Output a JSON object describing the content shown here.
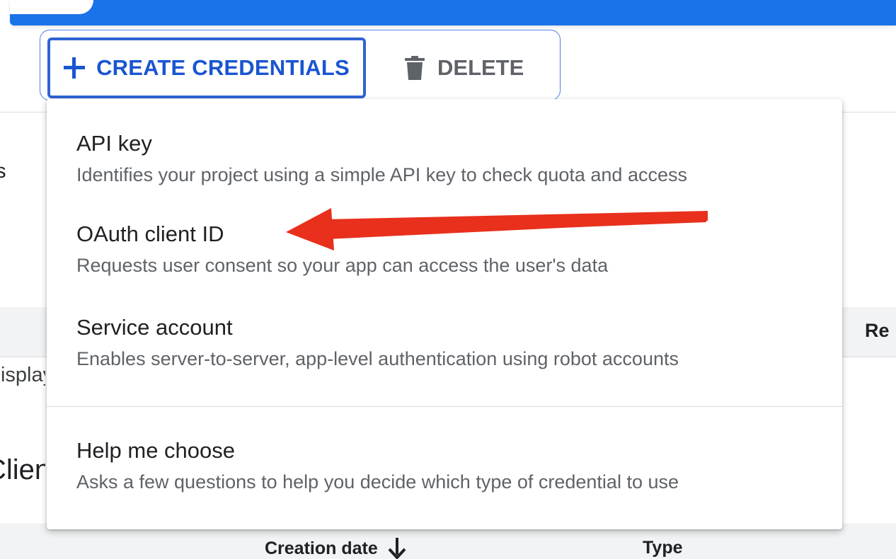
{
  "toolbar": {
    "create_label": "CREATE CREDENTIALS",
    "delete_label": "DELETE"
  },
  "background": {
    "fragment_1": "to access",
    "fragment_2": "Display name",
    "fragment_3": "Client",
    "fragment_4": "Re",
    "columns": [
      "Creation date",
      "Type"
    ]
  },
  "menu": {
    "items": [
      {
        "title": "API key",
        "description": "Identifies your project using a simple API key to check quota and access"
      },
      {
        "title": "OAuth client ID",
        "description": "Requests user consent so your app can access the user's data"
      },
      {
        "title": "Service account",
        "description": "Enables server-to-server, app-level authentication using robot accounts"
      },
      {
        "title": "Help me choose",
        "description": "Asks a few questions to help you decide which type of credential to use"
      }
    ]
  },
  "colors": {
    "primary_blue": "#1a73e8",
    "button_blue": "#1a55d1",
    "annotation_red": "#e8301c"
  },
  "icons": {
    "create": "plus-icon",
    "delete": "trash-icon",
    "sort": "arrow-down-icon",
    "annotation": "red-arrow-annotation"
  }
}
